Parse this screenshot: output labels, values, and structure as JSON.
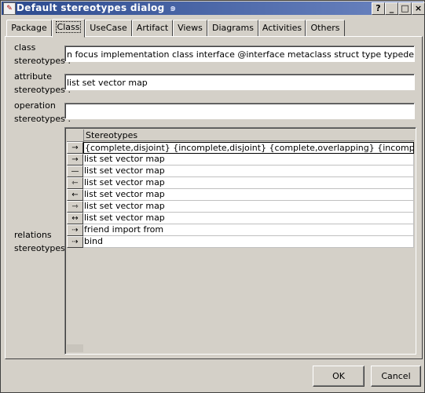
{
  "window": {
    "title": "Default stereotypes dialog",
    "buttons": [
      "?",
      "_",
      "□",
      "×"
    ]
  },
  "tabs": [
    {
      "label": "Package"
    },
    {
      "label": "Class",
      "active": true
    },
    {
      "label": "UseCase"
    },
    {
      "label": "Artifact"
    },
    {
      "label": "Views"
    },
    {
      "label": "Diagrams"
    },
    {
      "label": "Activities"
    },
    {
      "label": "Others"
    }
  ],
  "form": {
    "class_label_1": "class",
    "class_label_2": "stereotypes :",
    "class_value": "n focus implementation class interface @interface metaclass struct type typedef union utility",
    "attribute_label_1": "attribute",
    "attribute_label_2": "stereotypes :",
    "attribute_value": "list set vector map",
    "operation_label_1": "operation",
    "operation_label_2": "stereotypes :",
    "operation_value": "",
    "relations_label_1": "relations",
    "relations_label_2": "stereotypes :"
  },
  "relations_table": {
    "column_header": "Stereotypes",
    "rows": [
      {
        "icon": "→",
        "icon_name": "generalisation-arrow-icon",
        "value": "{complete,disjoint} {incomplete,disjoint} {complete,overlapping} {incomplete,overlapping}"
      },
      {
        "icon": "→",
        "icon_name": "directional-association-icon",
        "value": "list set vector map"
      },
      {
        "icon": "—",
        "icon_name": "association-icon",
        "value": "list set vector map"
      },
      {
        "icon": "⇽",
        "icon_name": "aggregation-icon",
        "value": "list set vector map"
      },
      {
        "icon": "←",
        "icon_name": "composition-icon",
        "value": "list set vector map"
      },
      {
        "icon": "⇾",
        "icon_name": "directional-aggregation-icon",
        "value": "list set vector map"
      },
      {
        "icon": "↔",
        "icon_name": "bidirectional-association-icon",
        "value": "list set vector map"
      },
      {
        "icon": "⇢",
        "icon_name": "dependency-icon",
        "value": "friend import from"
      },
      {
        "icon": "⇢",
        "icon_name": "realization-icon",
        "value": "bind"
      }
    ]
  },
  "footer": {
    "ok_label": "OK",
    "cancel_label": "Cancel"
  }
}
